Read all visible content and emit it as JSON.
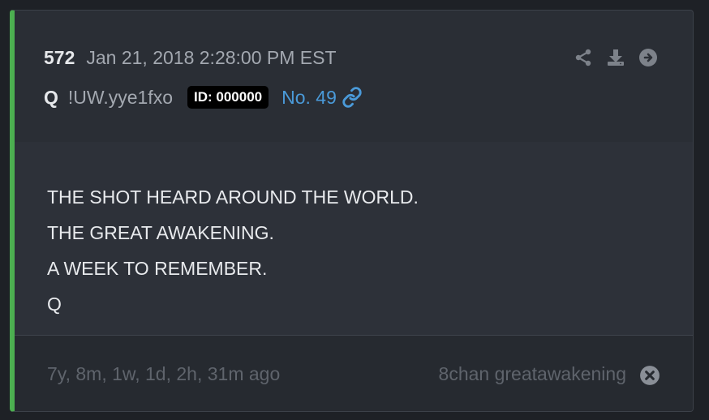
{
  "post": {
    "number": "572",
    "date": "Jan 21, 2018 2:28:00 PM EST",
    "author": "Q",
    "tripcode": "!UW.yye1fxo",
    "id_badge": "ID: 000000",
    "link_label": "No. 49"
  },
  "actions": {
    "icons": [
      "share-icon",
      "download-icon",
      "arrow-circle-right-icon"
    ],
    "icon_color": "#7d828a"
  },
  "message": {
    "lines": [
      "THE SHOT HEARD AROUND THE WORLD.",
      "THE GREAT AWAKENING.",
      "A WEEK TO REMEMBER.",
      "Q"
    ]
  },
  "footer": {
    "time_ago": "7y, 8m, 1w, 1d, 2h, 31m ago",
    "source": "8chan greatawakening"
  },
  "colors": {
    "accent_bar": "#4caf50",
    "link": "#4a9ad9",
    "badge_bg": "#000000"
  }
}
